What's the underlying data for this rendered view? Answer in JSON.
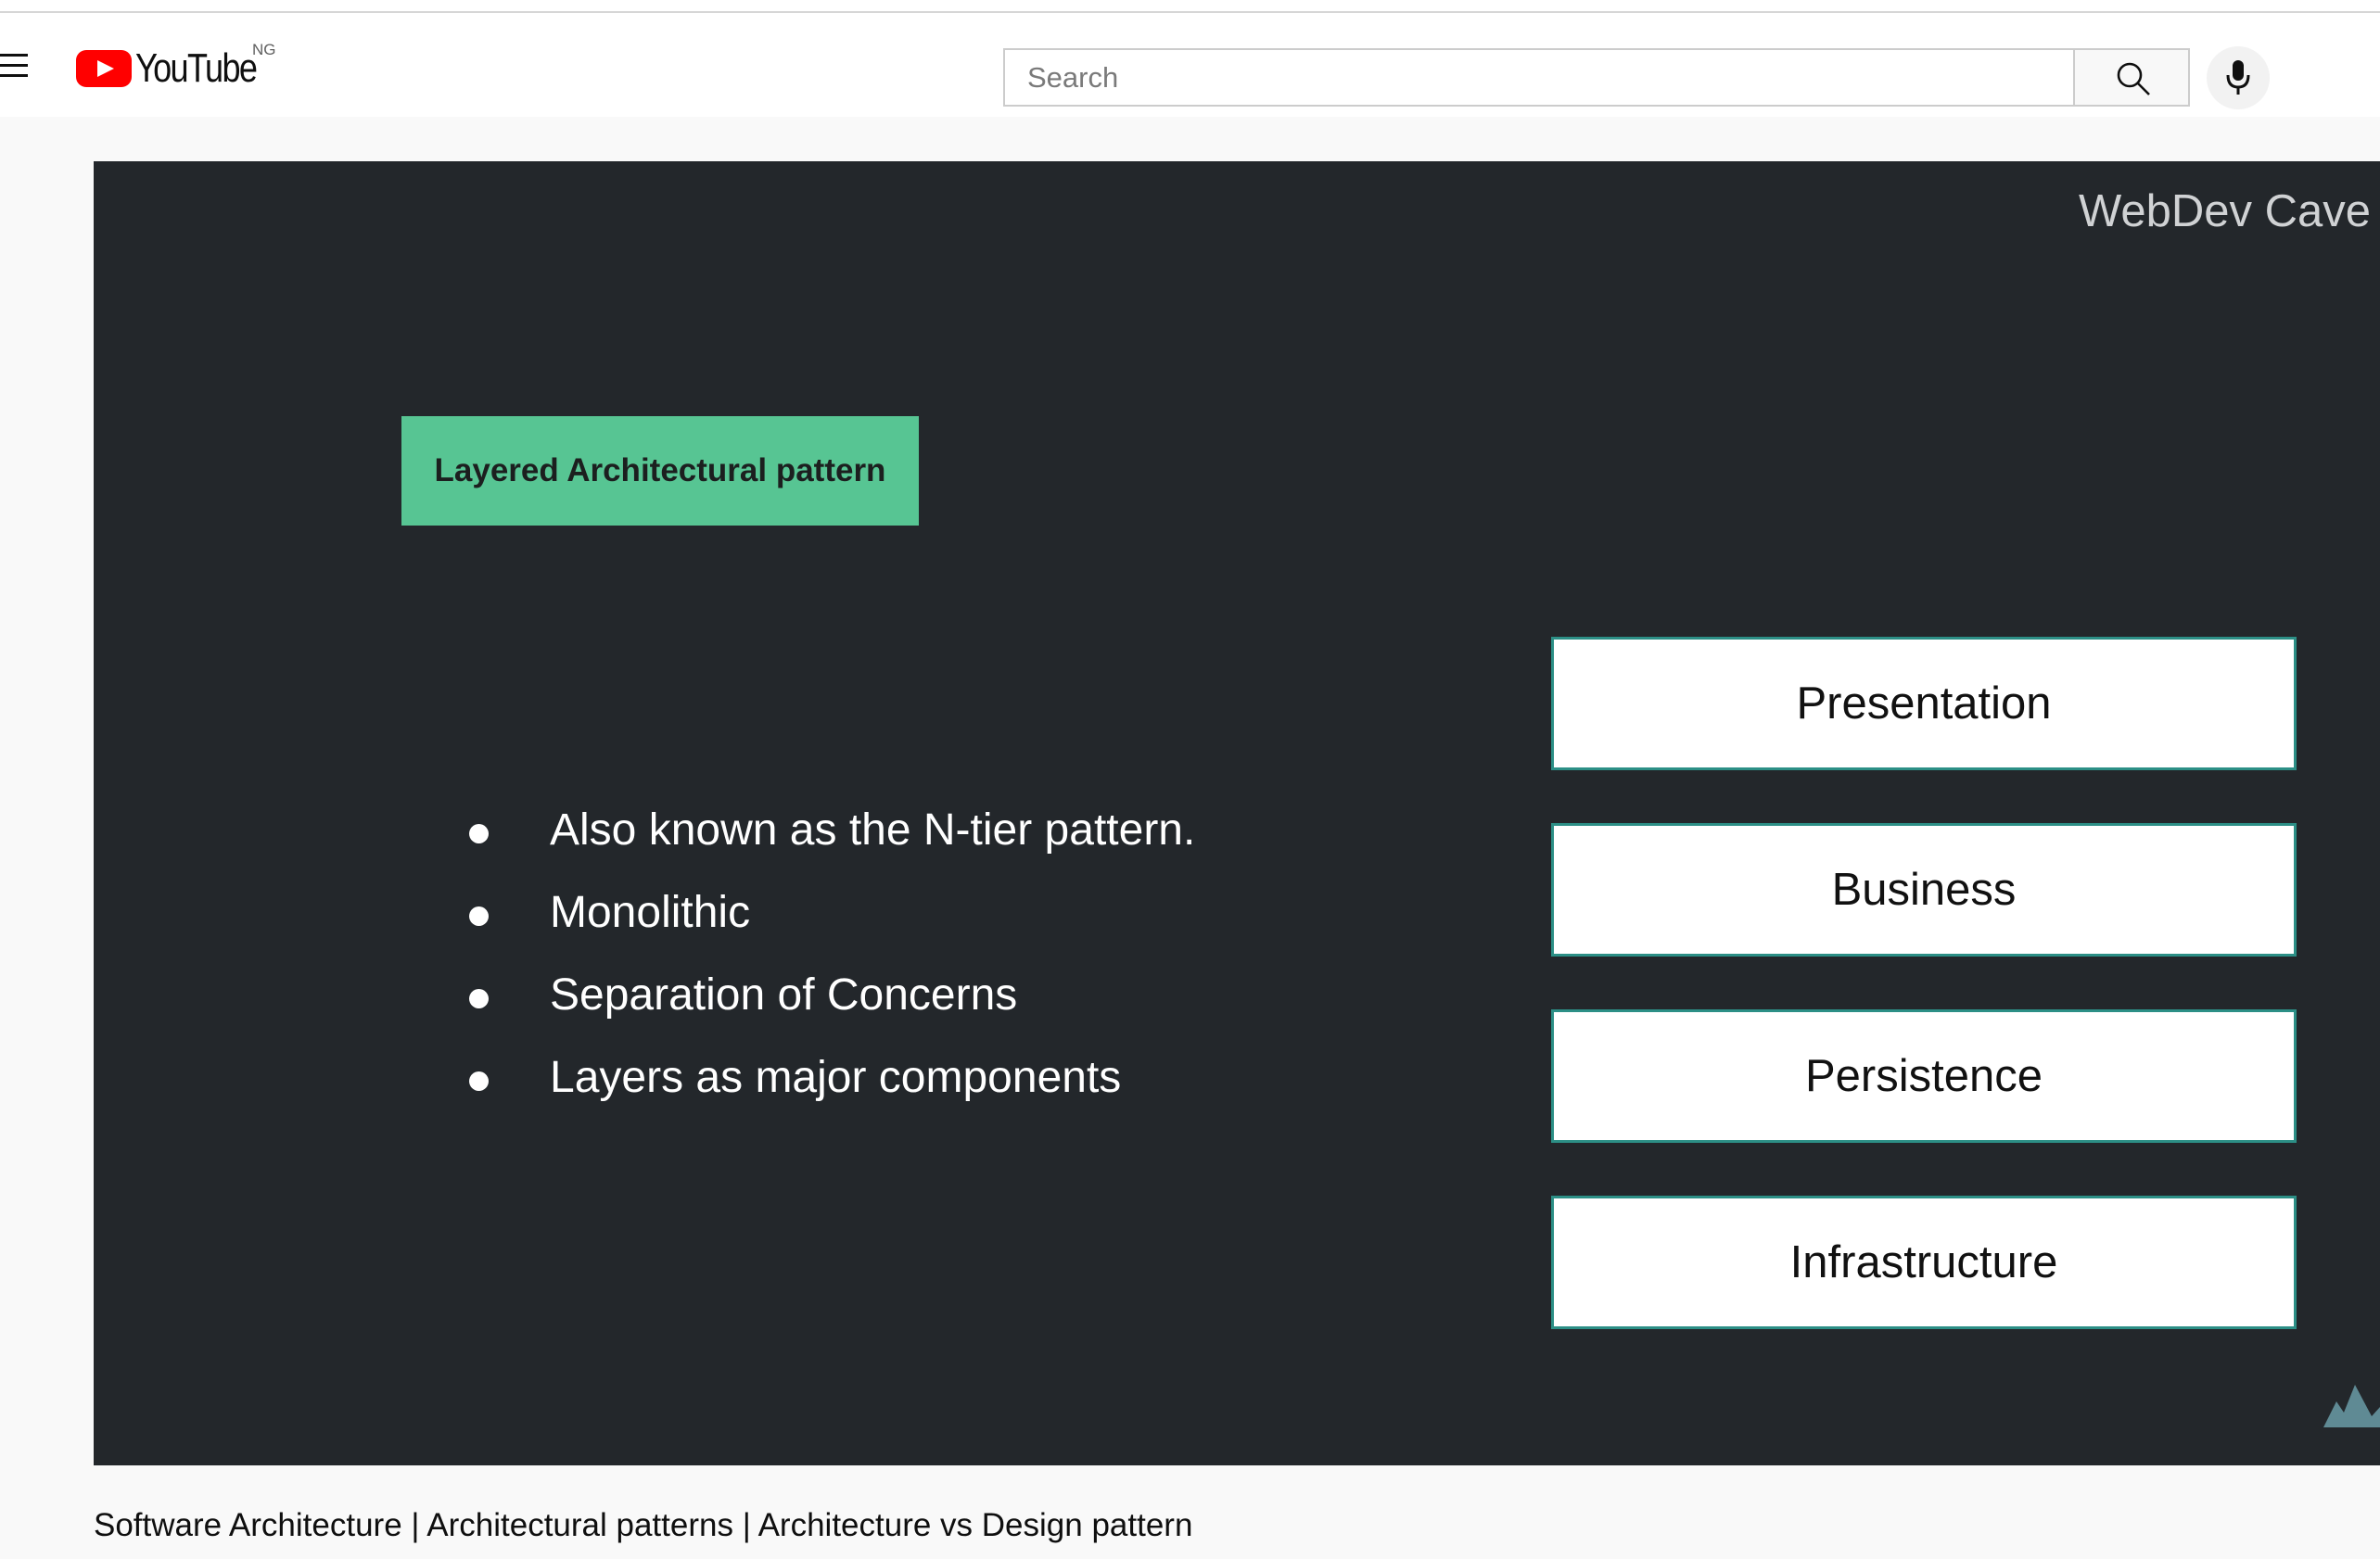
{
  "header": {
    "logo_text": "YouTube",
    "country_code": "NG",
    "search_placeholder": "Search"
  },
  "video": {
    "watermark": "WebDev Cave",
    "slide": {
      "title": "Layered Architectural pattern",
      "bullets": [
        "Also known as the N-tier pattern.",
        "Monolithic",
        "Separation of Concerns",
        "Layers as major components"
      ],
      "layers": [
        "Presentation",
        "Business",
        "Persistence",
        "Infrastructure"
      ]
    },
    "title": "Software Architecture | Architectural patterns | Architecture vs Design pattern"
  },
  "colors": {
    "brand_red": "#ff0000",
    "slide_background": "#23272b",
    "title_box": "#57c593",
    "layer_border": "#2c8f86"
  },
  "icons": {
    "menu": "hamburger-menu-icon",
    "search": "search-icon",
    "mic": "microphone-icon",
    "logo": "youtube-play-icon"
  }
}
